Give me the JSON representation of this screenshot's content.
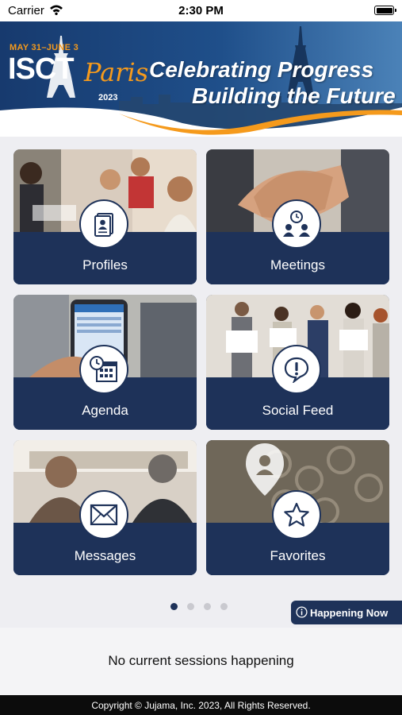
{
  "status_bar": {
    "carrier": "Carrier",
    "time": "2:30 PM",
    "icons": [
      "wifi-icon",
      "battery-icon"
    ]
  },
  "banner": {
    "dates": "MAY 31–JUNE 3",
    "org": "ISCT",
    "city": "Paris",
    "year": "2023",
    "tagline_line1": "Celebrating Progress",
    "tagline_line2": "Building the Future",
    "colors": {
      "navy": "#1b3a6b",
      "orange": "#f59a1c"
    }
  },
  "tiles": [
    {
      "label": "Profiles",
      "icon": "profile-card-icon"
    },
    {
      "label": "Meetings",
      "icon": "meeting-people-clock-icon"
    },
    {
      "label": "Agenda",
      "icon": "calendar-clock-icon"
    },
    {
      "label": "Social Feed",
      "icon": "speech-bubble-exclamation-icon"
    },
    {
      "label": "Messages",
      "icon": "envelope-icon"
    },
    {
      "label": "Favorites",
      "icon": "star-icon"
    }
  ],
  "pagination": {
    "total_pages": 4,
    "current_page": 1
  },
  "happening_now": {
    "label": "Happening Now",
    "icon": "info-icon"
  },
  "sessions": {
    "empty_message": "No current sessions happening"
  },
  "footer": {
    "copyright": "Copyright © Jujama, Inc. 2023, All Rights Reserved."
  },
  "colors": {
    "tile_band": "#1e3259",
    "background": "#eeeef2",
    "footer": "#0c0c0c"
  }
}
